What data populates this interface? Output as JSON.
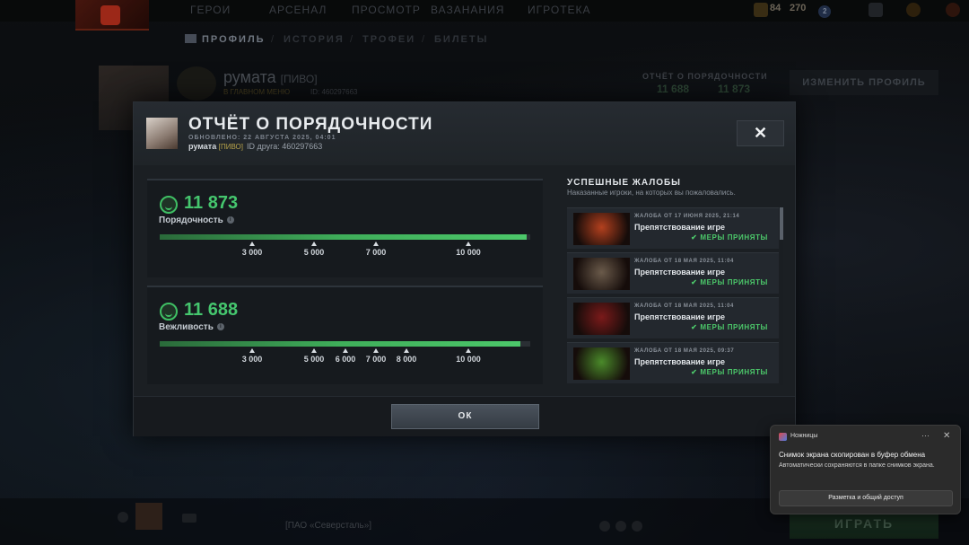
{
  "top_nav": {
    "items": [
      "ГЕРОИ",
      "АРСЕНАЛ",
      "ПРОСМОТР",
      "ВАЗАНАНИЯ",
      "ИГРОТЕКА"
    ],
    "currency_a": "84",
    "currency_b": "270",
    "notif_count": "2"
  },
  "sub_nav": {
    "items": [
      "ПРОФИЛЬ",
      "ИСТОРИЯ",
      "ТРОФЕИ",
      "БИЛЕТЫ"
    ]
  },
  "profile_bg": {
    "name": "румата",
    "tag": "[ПИВО]",
    "menu_link": "В ГЛАВНОМ МЕНЮ",
    "id_text": "ID: 460297663",
    "report_label": "ОТЧЁТ О ПОРЯДОЧНОСТИ",
    "conduct_value": "11 688",
    "conduct_value_b": "11 873",
    "edit_button": "ИЗМЕНИТЬ ПРОФИЛЬ"
  },
  "modal": {
    "title": "ОТЧЁТ О ПОРЯДОЧНОСТИ",
    "updated": "ОБНОВЛЕНО: 22 АВГУСТА 2025, 04:01",
    "player_name": "румата",
    "player_tag": "[ПИВО]",
    "friend_id": "ID друга: 460297663",
    "close_icon": "close-icon",
    "ok_label": "ОК"
  },
  "behavior": {
    "score": "11 873",
    "label": "Порядочность",
    "fill_fraction": 0.99,
    "ticks": [
      {
        "label": "3 000",
        "pos": 0.25
      },
      {
        "label": "5 000",
        "pos": 0.4167
      },
      {
        "label": "7 000",
        "pos": 0.5833
      },
      {
        "label": "10 000",
        "pos": 0.8333
      }
    ]
  },
  "communication": {
    "score": "11 688",
    "label": "Вежливость",
    "fill_fraction": 0.974,
    "ticks": [
      {
        "label": "3 000",
        "pos": 0.25
      },
      {
        "label": "5 000",
        "pos": 0.4167
      },
      {
        "label": "6 000",
        "pos": 0.5
      },
      {
        "label": "7 000",
        "pos": 0.5833
      },
      {
        "label": "8 000",
        "pos": 0.6667
      },
      {
        "label": "10 000",
        "pos": 0.8333
      }
    ]
  },
  "reports": {
    "title": "УСПЕШНЫЕ ЖАЛОБЫ",
    "subtitle": "Наказанные игроки, на которых вы пожаловались.",
    "items": [
      {
        "date": "ЖАЛОБА ОТ 17 ИЮНЯ 2025, 21:14",
        "reason": "Препятствование игре",
        "status": "МЕРЫ ПРИНЯТЫ",
        "hero_color": "#b3401e"
      },
      {
        "date": "ЖАЛОБА ОТ 18 МАЯ 2025, 11:04",
        "reason": "Препятствование игре",
        "status": "МЕРЫ ПРИНЯТЫ",
        "hero_color": "#6a5a4a"
      },
      {
        "date": "ЖАЛОБА ОТ 18 МАЯ 2025, 11:04",
        "reason": "Препятствование игре",
        "status": "МЕРЫ ПРИНЯТЫ",
        "hero_color": "#7a1a1a"
      },
      {
        "date": "ЖАЛОБА ОТ 18 МАЯ 2025, 09:37",
        "reason": "Препятствование игре",
        "status": "МЕРЫ ПРИНЯТЫ",
        "hero_color": "#4a8a2a"
      }
    ]
  },
  "bottom_bar": {
    "play_button": "ИГРАТЬ",
    "chat_text": "[ПАО «Северсталь»]"
  },
  "toast": {
    "app": "Ножницы",
    "more_icon": "more-icon",
    "heading": "Снимок экрана скопирован в буфер обмена",
    "body": "Автоматически сохраняются в папке снимков экрана.",
    "button": "Разметка и общий доступ"
  }
}
